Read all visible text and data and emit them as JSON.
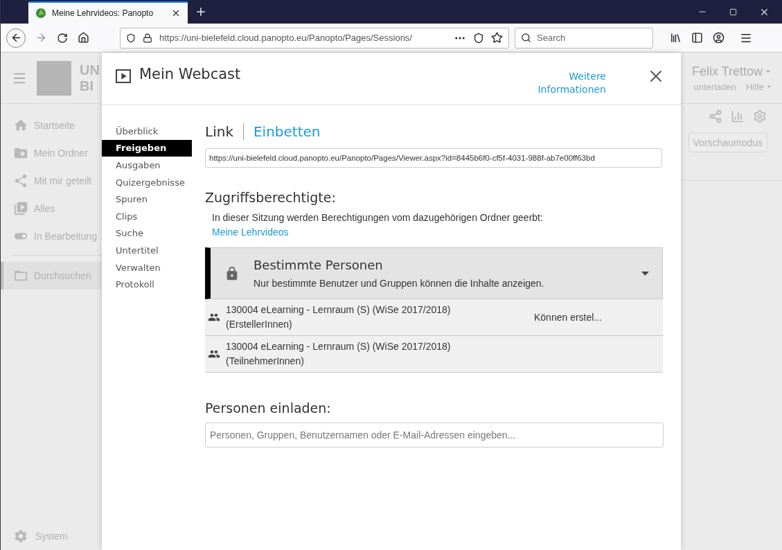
{
  "browser": {
    "tab": {
      "title": "Meine Lehrvideos: Panopto",
      "selected": true
    },
    "url": "https://uni-bielefeld.cloud.panopto.eu/Panopto/Pages/Sessions/",
    "search": {
      "placeholder": "Search"
    }
  },
  "background": {
    "logo": [
      "UN",
      "BI"
    ],
    "user": "Felix Trettow",
    "header_links": [
      "unterladen",
      "Hilfe"
    ],
    "sidebar": [
      {
        "label": "Startseite",
        "selected": false
      },
      {
        "label": "Mein Ordner",
        "selected": false
      },
      {
        "label": "Mit mir geteilt",
        "selected": false
      },
      {
        "label": "Alles",
        "selected": false
      },
      {
        "label": "In Bearbeitung",
        "selected": false
      },
      {
        "label": "Durchsuchen",
        "selected": true
      }
    ],
    "system": "System",
    "preview_button": "Vorschaumodus"
  },
  "modal": {
    "title": "Mein Webcast",
    "info_link": "Weitere Informationen",
    "nav": [
      {
        "label": "Überblick",
        "selected": false
      },
      {
        "label": "Freigeben",
        "selected": true
      },
      {
        "label": "Ausgaben",
        "selected": false
      },
      {
        "label": "Quizergebnisse",
        "selected": false
      },
      {
        "label": "Spuren",
        "selected": false
      },
      {
        "label": "Clips",
        "selected": false
      },
      {
        "label": "Suche",
        "selected": false
      },
      {
        "label": "Untertitel",
        "selected": false
      },
      {
        "label": "Verwalten",
        "selected": false
      },
      {
        "label": "Protokoll",
        "selected": false
      }
    ],
    "share_tabs": [
      {
        "label": "Link",
        "selected": true
      },
      {
        "label": "Einbetten",
        "selected": false
      }
    ],
    "link_url": "https://uni-bielefeld.cloud.panopto.eu/Panopto/Pages/Viewer.aspx?id=8445b6f0-cf5f-4031-988f-ab7e00ff63bd",
    "access": {
      "heading": "Zugriffsberechtigte:",
      "inherit_text": "In dieser Sitzung werden Berechtigungen vom dazugehörigen Ordner geerbt:",
      "inherit_link": "Meine Lehrvideos",
      "mode": {
        "title": "Bestimmte Personen",
        "description": "Nur bestimmte Benutzer und Gruppen können die Inhalte anzeigen."
      },
      "members": [
        {
          "name": "130004 eLearning - Lernraum (S) (WiSe 2017/2018) (ErstellerInnen)",
          "role": "Können erstel..."
        },
        {
          "name": "130004 eLearning - Lernraum (S) (WiSe 2017/2018) (TeilnehmerInnen)"
        }
      ]
    },
    "invite": {
      "heading": "Personen einladen:",
      "placeholder": "Personen, Gruppen, Benutzernamen oder E-Mail-Adressen eingeben..."
    }
  }
}
